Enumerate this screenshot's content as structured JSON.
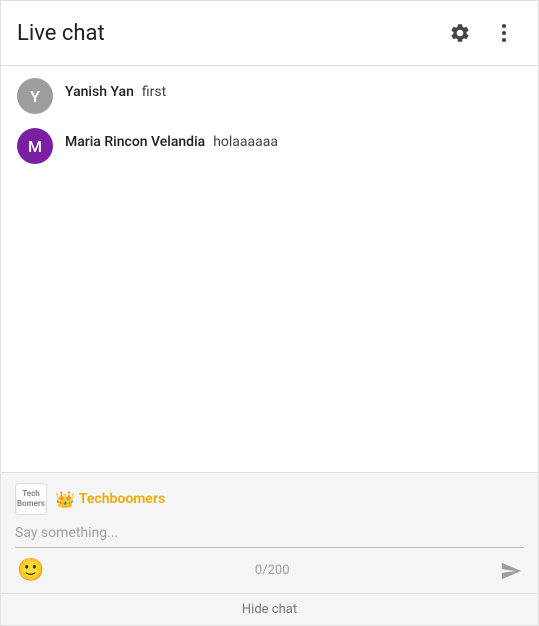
{
  "header": {
    "title": "Live chat"
  },
  "messages": [
    {
      "id": "msg-1",
      "author": "Yanish Yan",
      "text": "first",
      "avatar_letter": "Y",
      "avatar_color": "gray"
    },
    {
      "id": "msg-2",
      "author": "Maria Rincon Velandia",
      "text": "holaaaaaa",
      "avatar_letter": "M",
      "avatar_color": "purple"
    }
  ],
  "input": {
    "channel_name": "Techboomers",
    "channel_icon_text": "Tech\nBomers",
    "placeholder": "Say something...",
    "char_count": "0/200"
  },
  "footer": {
    "hide_label": "Hide chat"
  }
}
